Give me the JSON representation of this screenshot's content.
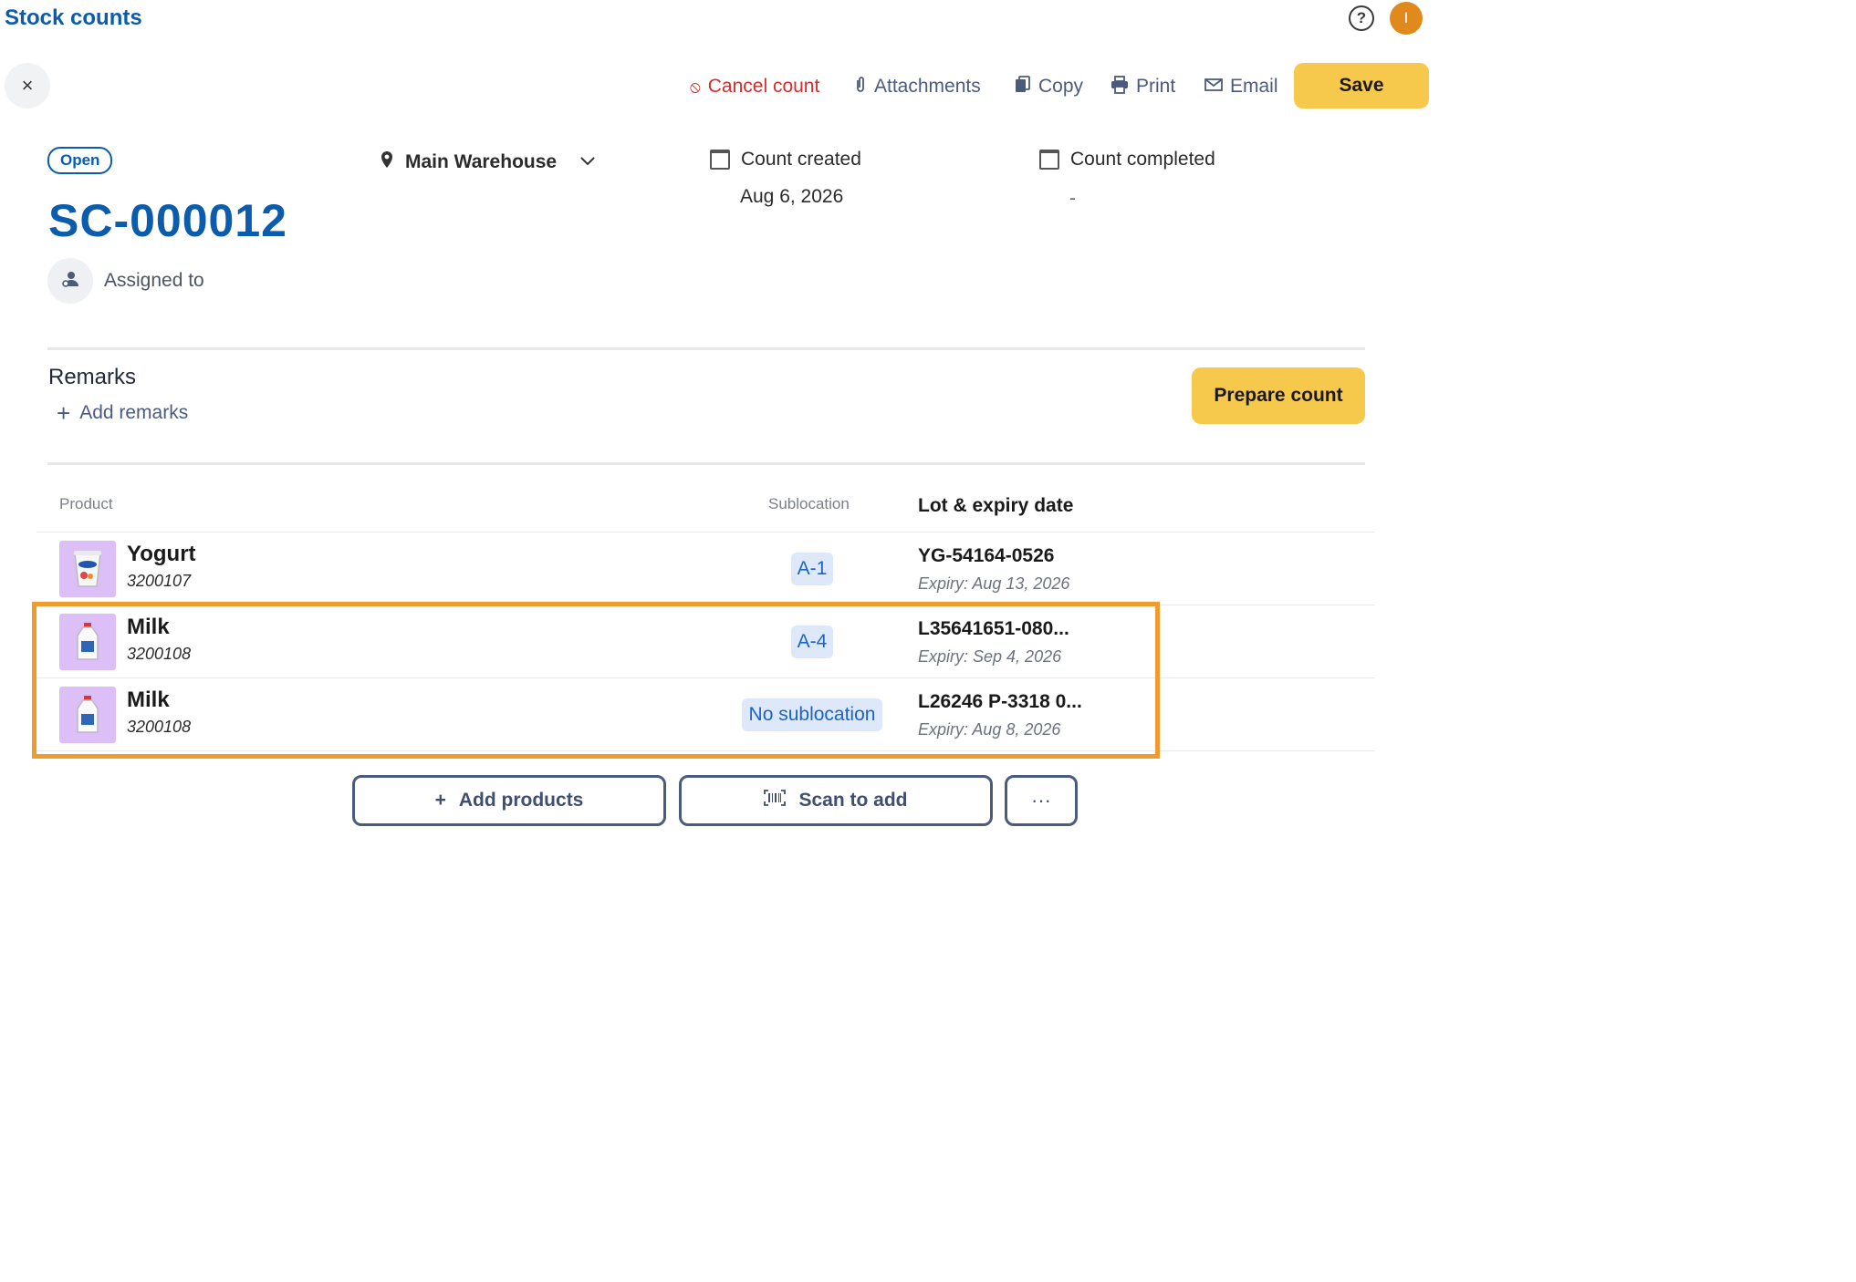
{
  "header": {
    "title": "Stock counts",
    "help_label": "?",
    "user_initial": "I"
  },
  "toolbar": {
    "close_label": "×",
    "cancel_label": "Cancel count",
    "attachments_label": "Attachments",
    "copy_label": "Copy",
    "print_label": "Print",
    "email_label": "Email",
    "save_label": "Save"
  },
  "count": {
    "status": "Open",
    "id": "SC-000012",
    "assigned_label": "Assigned to",
    "location": "Main Warehouse",
    "created_label": "Count created",
    "created_value": "Aug 6, 2026",
    "completed_label": "Count completed",
    "completed_value": "-"
  },
  "remarks": {
    "title": "Remarks",
    "add_label": "Add remarks",
    "prepare_label": "Prepare count"
  },
  "table": {
    "headers": {
      "product": "Product",
      "sublocation": "Sublocation",
      "lot": "Lot & expiry date"
    },
    "rows": [
      {
        "name": "Yogurt",
        "sku": "3200107",
        "sublocation": "A-1",
        "lot": "YG-54164-0526",
        "expiry": "Expiry: Aug 13, 2026"
      },
      {
        "name": "Milk",
        "sku": "3200108",
        "sublocation": "A-4",
        "lot": "L35641651-080...",
        "expiry": "Expiry: Sep 4, 2026"
      },
      {
        "name": "Milk",
        "sku": "3200108",
        "sublocation": "No sublocation",
        "lot": "L26246 P-3318 0...",
        "expiry": "Expiry: Aug 8, 2026"
      }
    ]
  },
  "actions": {
    "add_products_label": "Add products",
    "scan_label": "Scan to add",
    "more_label": "···"
  },
  "colors": {
    "brand": "#0b5cad",
    "accent": "#f6c84c",
    "danger": "#d12e2e",
    "highlight": "#ee9b30"
  }
}
